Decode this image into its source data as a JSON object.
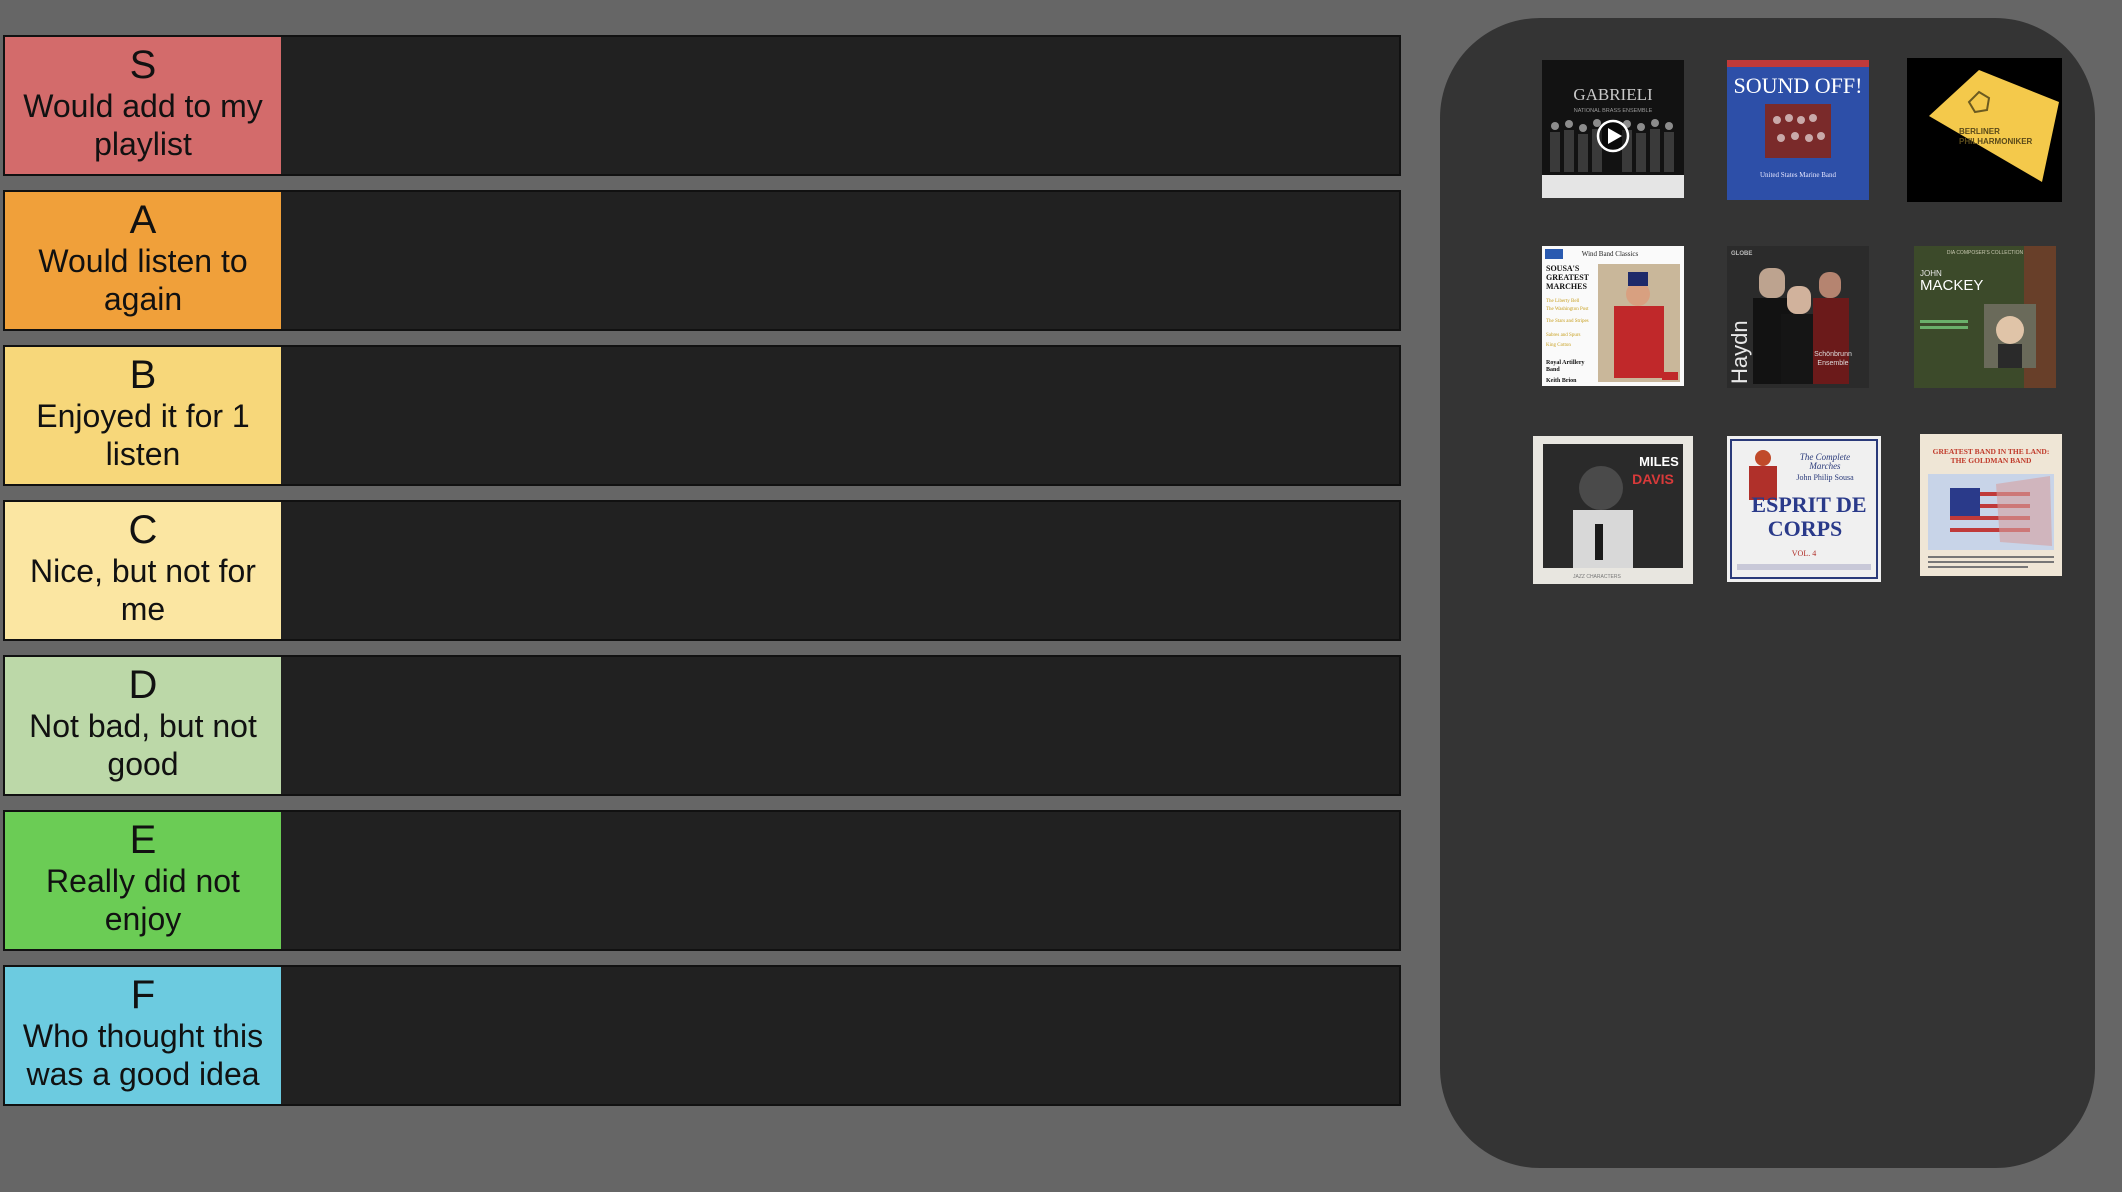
{
  "tiers": [
    {
      "letter": "S",
      "desc": "Would add to my playlist",
      "color": "#d36b6b"
    },
    {
      "letter": "A",
      "desc": "Would listen to again",
      "color": "#f0a03a"
    },
    {
      "letter": "B",
      "desc": "Enjoyed it for 1 listen",
      "color": "#f7d77a"
    },
    {
      "letter": "C",
      "desc": "Nice, but not for me",
      "color": "#fbe6a2"
    },
    {
      "letter": "D",
      "desc": "Not bad, but not good",
      "color": "#bcd8a8"
    },
    {
      "letter": "E",
      "desc": "Really did not enjoy",
      "color": "#6bcc55"
    },
    {
      "letter": "F",
      "desc": "Who thought this was a good idea",
      "color": "#6ccbe0"
    }
  ],
  "pool": {
    "albums": [
      {
        "title": "GABRIELI",
        "subtitle": "NATIONAL BRASS ENSEMBLE",
        "icon": "play-icon"
      },
      {
        "title": "SOUND OFF!",
        "subtitle": "United States Marine Band"
      },
      {
        "title": "BERLINER PHILHARMONIKER"
      },
      {
        "title": "Wind Band Classics",
        "subtitle": "SOUSA'S GREATEST MARCHES",
        "tracks": [
          "The Liberty Bell",
          "The Washington Post",
          "The Stars and Stripes Forever",
          "Sabres and Spurs",
          "King Cotton"
        ],
        "credit": "Royal Artillery Band",
        "credit2": "Keith Brion"
      },
      {
        "title": "Haydn",
        "subtitle": "Schönbrunn Ensemble",
        "label": "GLOBE"
      },
      {
        "title": "MACKEY",
        "subtitle": "JOHN",
        "label": "DIA COMPOSER'S COLLECTION"
      },
      {
        "title": "MILES DAVIS",
        "subtitle": "JAZZ CHARACTERS"
      },
      {
        "title": "ESPRIT DE CORPS",
        "subtitle": "The Complete Marches John Philip Sousa",
        "badge": "VOL. 4"
      },
      {
        "title": "GREATEST BAND IN THE LAND: THE GOLDMAN BAND"
      }
    ]
  }
}
